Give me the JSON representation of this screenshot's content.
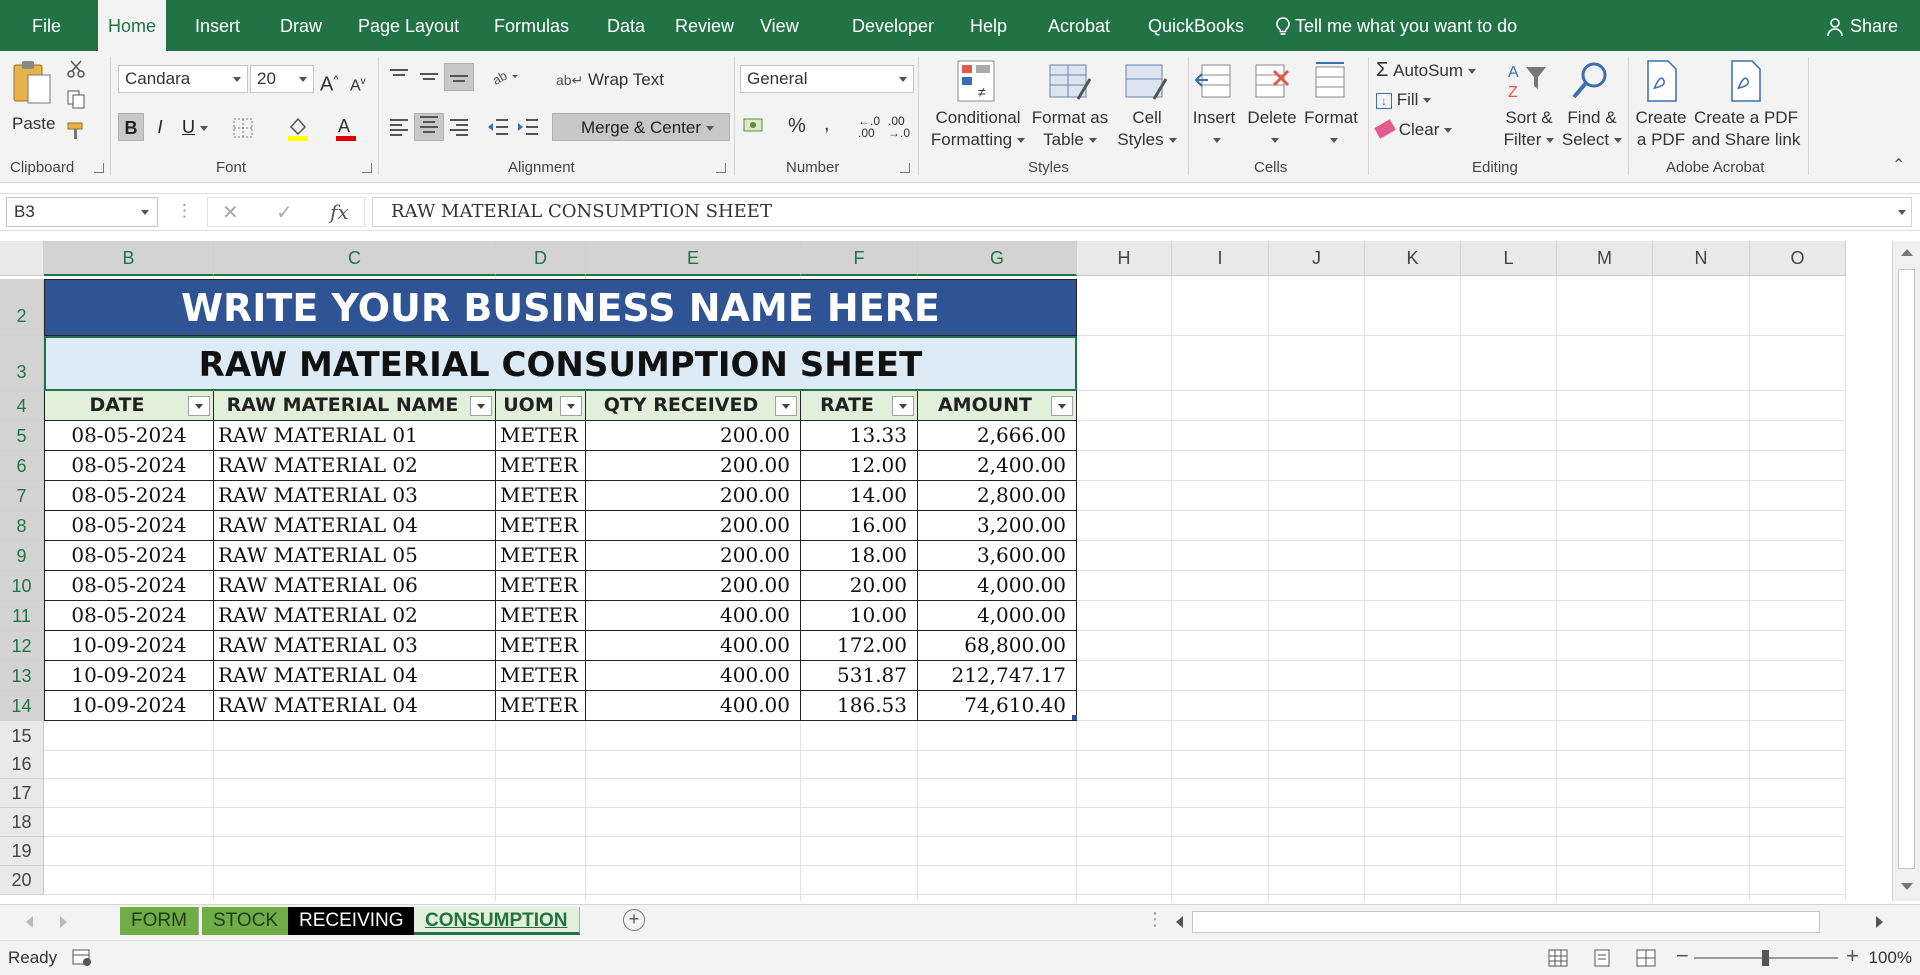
{
  "menu": {
    "tabs": [
      "File",
      "Home",
      "Insert",
      "Draw",
      "Page Layout",
      "Formulas",
      "Data",
      "Review",
      "View",
      "Developer",
      "Help",
      "Acrobat",
      "QuickBooks"
    ],
    "active": "Home",
    "tell_me": "Tell me what you want to do",
    "share": "Share"
  },
  "ribbon": {
    "clipboard": {
      "paste": "Paste",
      "label": "Clipboard"
    },
    "font": {
      "name": "Candara",
      "size": "20",
      "bold": "B",
      "italic": "I",
      "underline": "U",
      "label": "Font"
    },
    "alignment": {
      "wrap_text": "Wrap Text",
      "merge_center": "Merge & Center",
      "label": "Alignment"
    },
    "number": {
      "format": "General",
      "label": "Number"
    },
    "styles": {
      "conditional": "Conditional",
      "conditional2": "Formatting",
      "format_as": "Format as",
      "format_as2": "Table",
      "cell": "Cell",
      "cell2": "Styles",
      "label": "Styles"
    },
    "cells": {
      "insert": "Insert",
      "delete": "Delete",
      "format": "Format",
      "label": "Cells"
    },
    "editing": {
      "autosum": "AutoSum",
      "fill": "Fill",
      "clear": "Clear",
      "sort": "Sort &",
      "sort2": "Filter",
      "find": "Find &",
      "find2": "Select",
      "label": "Editing"
    },
    "acrobat": {
      "create": "Create",
      "create2": "a PDF",
      "share": "Create a PDF",
      "share2": "and Share link",
      "label": "Adobe Acrobat"
    }
  },
  "formula_bar": {
    "name_box": "B3",
    "formula": "RAW MATERIAL CONSUMPTION SHEET"
  },
  "columns": [
    "B",
    "C",
    "D",
    "E",
    "F",
    "G",
    "H",
    "I",
    "J",
    "K",
    "L",
    "M",
    "N",
    "O"
  ],
  "rows": [
    "2",
    "3",
    "4",
    "5",
    "6",
    "7",
    "8",
    "9",
    "10",
    "11",
    "12",
    "13",
    "14",
    "15",
    "16",
    "17",
    "18",
    "19",
    "20"
  ],
  "sheet": {
    "title": "WRITE YOUR BUSINESS NAME HERE",
    "subtitle": "RAW MATERIAL CONSUMPTION SHEET",
    "headers": [
      "DATE",
      "RAW MATERIAL NAME",
      "UOM",
      "QTY RECEIVED",
      "RATE",
      "AMOUNT"
    ],
    "data": [
      [
        "08-05-2024",
        "RAW MATERIAL 01",
        "METER",
        "200.00",
        "13.33",
        "2,666.00"
      ],
      [
        "08-05-2024",
        "RAW MATERIAL 02",
        "METER",
        "200.00",
        "12.00",
        "2,400.00"
      ],
      [
        "08-05-2024",
        "RAW MATERIAL 03",
        "METER",
        "200.00",
        "14.00",
        "2,800.00"
      ],
      [
        "08-05-2024",
        "RAW MATERIAL 04",
        "METER",
        "200.00",
        "16.00",
        "3,200.00"
      ],
      [
        "08-05-2024",
        "RAW MATERIAL 05",
        "METER",
        "200.00",
        "18.00",
        "3,600.00"
      ],
      [
        "08-05-2024",
        "RAW MATERIAL 06",
        "METER",
        "200.00",
        "20.00",
        "4,000.00"
      ],
      [
        "08-05-2024",
        "RAW MATERIAL 02",
        "METER",
        "400.00",
        "10.00",
        "4,000.00"
      ],
      [
        "10-09-2024",
        "RAW MATERIAL 03",
        "METER",
        "400.00",
        "172.00",
        "68,800.00"
      ],
      [
        "10-09-2024",
        "RAW MATERIAL 04",
        "METER",
        "400.00",
        "531.87",
        "212,747.17"
      ],
      [
        "10-09-2024",
        "RAW MATERIAL 04",
        "METER",
        "400.00",
        "186.53",
        "74,610.40"
      ]
    ]
  },
  "sheet_tabs": [
    {
      "label": "FORM",
      "bg": "#70ad47",
      "color": "#1a3d1a"
    },
    {
      "label": "STOCK",
      "bg": "#70ad47",
      "color": "#1a3d1a"
    },
    {
      "label": "RECEIVING",
      "bg": "#000000",
      "color": "#ffffff"
    },
    {
      "label": "CONSUMPTION",
      "bg": "#e2efda",
      "color": "#217346"
    }
  ],
  "status": {
    "ready": "Ready",
    "zoom": "100%"
  },
  "colors": {
    "excel_green": "#217346",
    "title_blue": "#2f5496",
    "subtitle_blue": "#ddebf7",
    "header_green": "#e2efda"
  }
}
